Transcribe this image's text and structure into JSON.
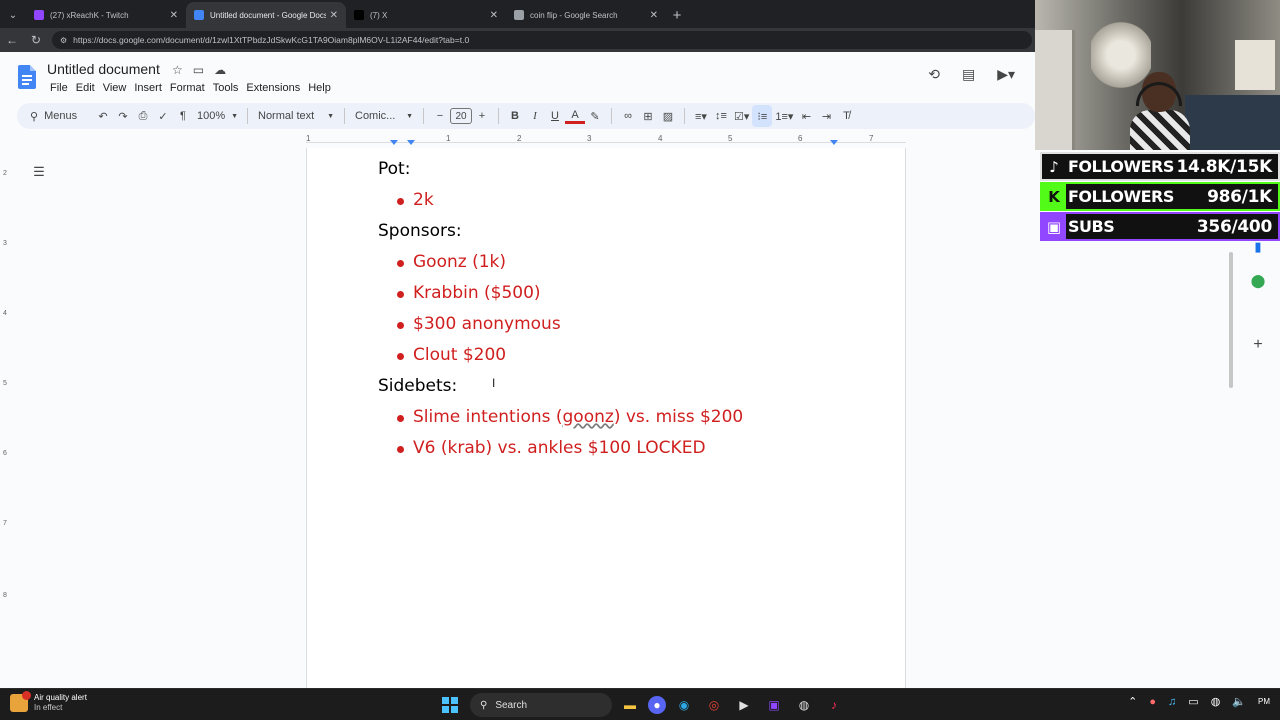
{
  "browser": {
    "tabs": [
      {
        "label": "(27) xReachK - Twitch",
        "active": false,
        "fav_color": "#9146ff"
      },
      {
        "label": "Untitled document - Google Docs",
        "active": true,
        "fav_color": "#4285f4"
      },
      {
        "label": "(7) X",
        "active": false,
        "fav_color": "#000000"
      },
      {
        "label": "coin flip - Google Search",
        "active": false,
        "fav_color": "#9aa0a6"
      }
    ],
    "new_tab": "+",
    "url": "https://docs.google.com/document/d/1zwl1XtTPbdzJdSkwKcG1TA9Oiam8plM6OV-L1i2AF44/edit?tab=t.0"
  },
  "docs": {
    "title": "Untitled document",
    "menu": [
      "File",
      "Edit",
      "View",
      "Insert",
      "Format",
      "Tools",
      "Extensions",
      "Help"
    ],
    "toolbar": {
      "menus": "Menus",
      "zoom": "100%",
      "style": "Normal text",
      "font": "Comic...",
      "font_size": "20"
    },
    "ruler": [
      "1",
      "1",
      "2",
      "3",
      "4",
      "5",
      "6",
      "7"
    ],
    "vruler": [
      "2",
      "3",
      "4",
      "5",
      "6",
      "7",
      "8"
    ],
    "content": [
      {
        "type": "heading",
        "text": "Pot:"
      },
      {
        "type": "bullet",
        "text": "2k"
      },
      {
        "type": "heading",
        "text": "Sponsors:"
      },
      {
        "type": "bullet",
        "text": "Goonz (1k)"
      },
      {
        "type": "bullet",
        "text": "Krabbin ($500)"
      },
      {
        "type": "bullet",
        "text": "$300 anonymous"
      },
      {
        "type": "bullet",
        "text": "Clout $200"
      },
      {
        "type": "heading",
        "text": "Sidebets:"
      },
      {
        "type": "bullet_parts",
        "before": "Slime intentions (",
        "underlined": "goonz",
        "after": ") vs. miss $200"
      },
      {
        "type": "bullet",
        "text": "V6 (krab) vs. ankles $100 LOCKED"
      }
    ]
  },
  "stream_stats": [
    {
      "label": "FOLLOWERS",
      "value": "14.8K/15K",
      "border": "#e0e0e0",
      "icon_bg": "#111111",
      "icon": "♪"
    },
    {
      "label": "FOLLOWERS",
      "value": "986/1K",
      "border": "#53fc18",
      "icon_bg": "#53fc18",
      "icon": "K"
    },
    {
      "label": "SUBS",
      "value": "356/400",
      "border": "#9146ff",
      "icon_bg": "#9146ff",
      "icon": "▣"
    }
  ],
  "taskbar": {
    "weather_title": "Air quality alert",
    "weather_sub": "In effect",
    "search": "Search",
    "time": "PM"
  },
  "colors": {
    "accent": "#4285f4",
    "bullet_text": "#d01f1f",
    "toolbar_bg": "#edf2fa"
  }
}
